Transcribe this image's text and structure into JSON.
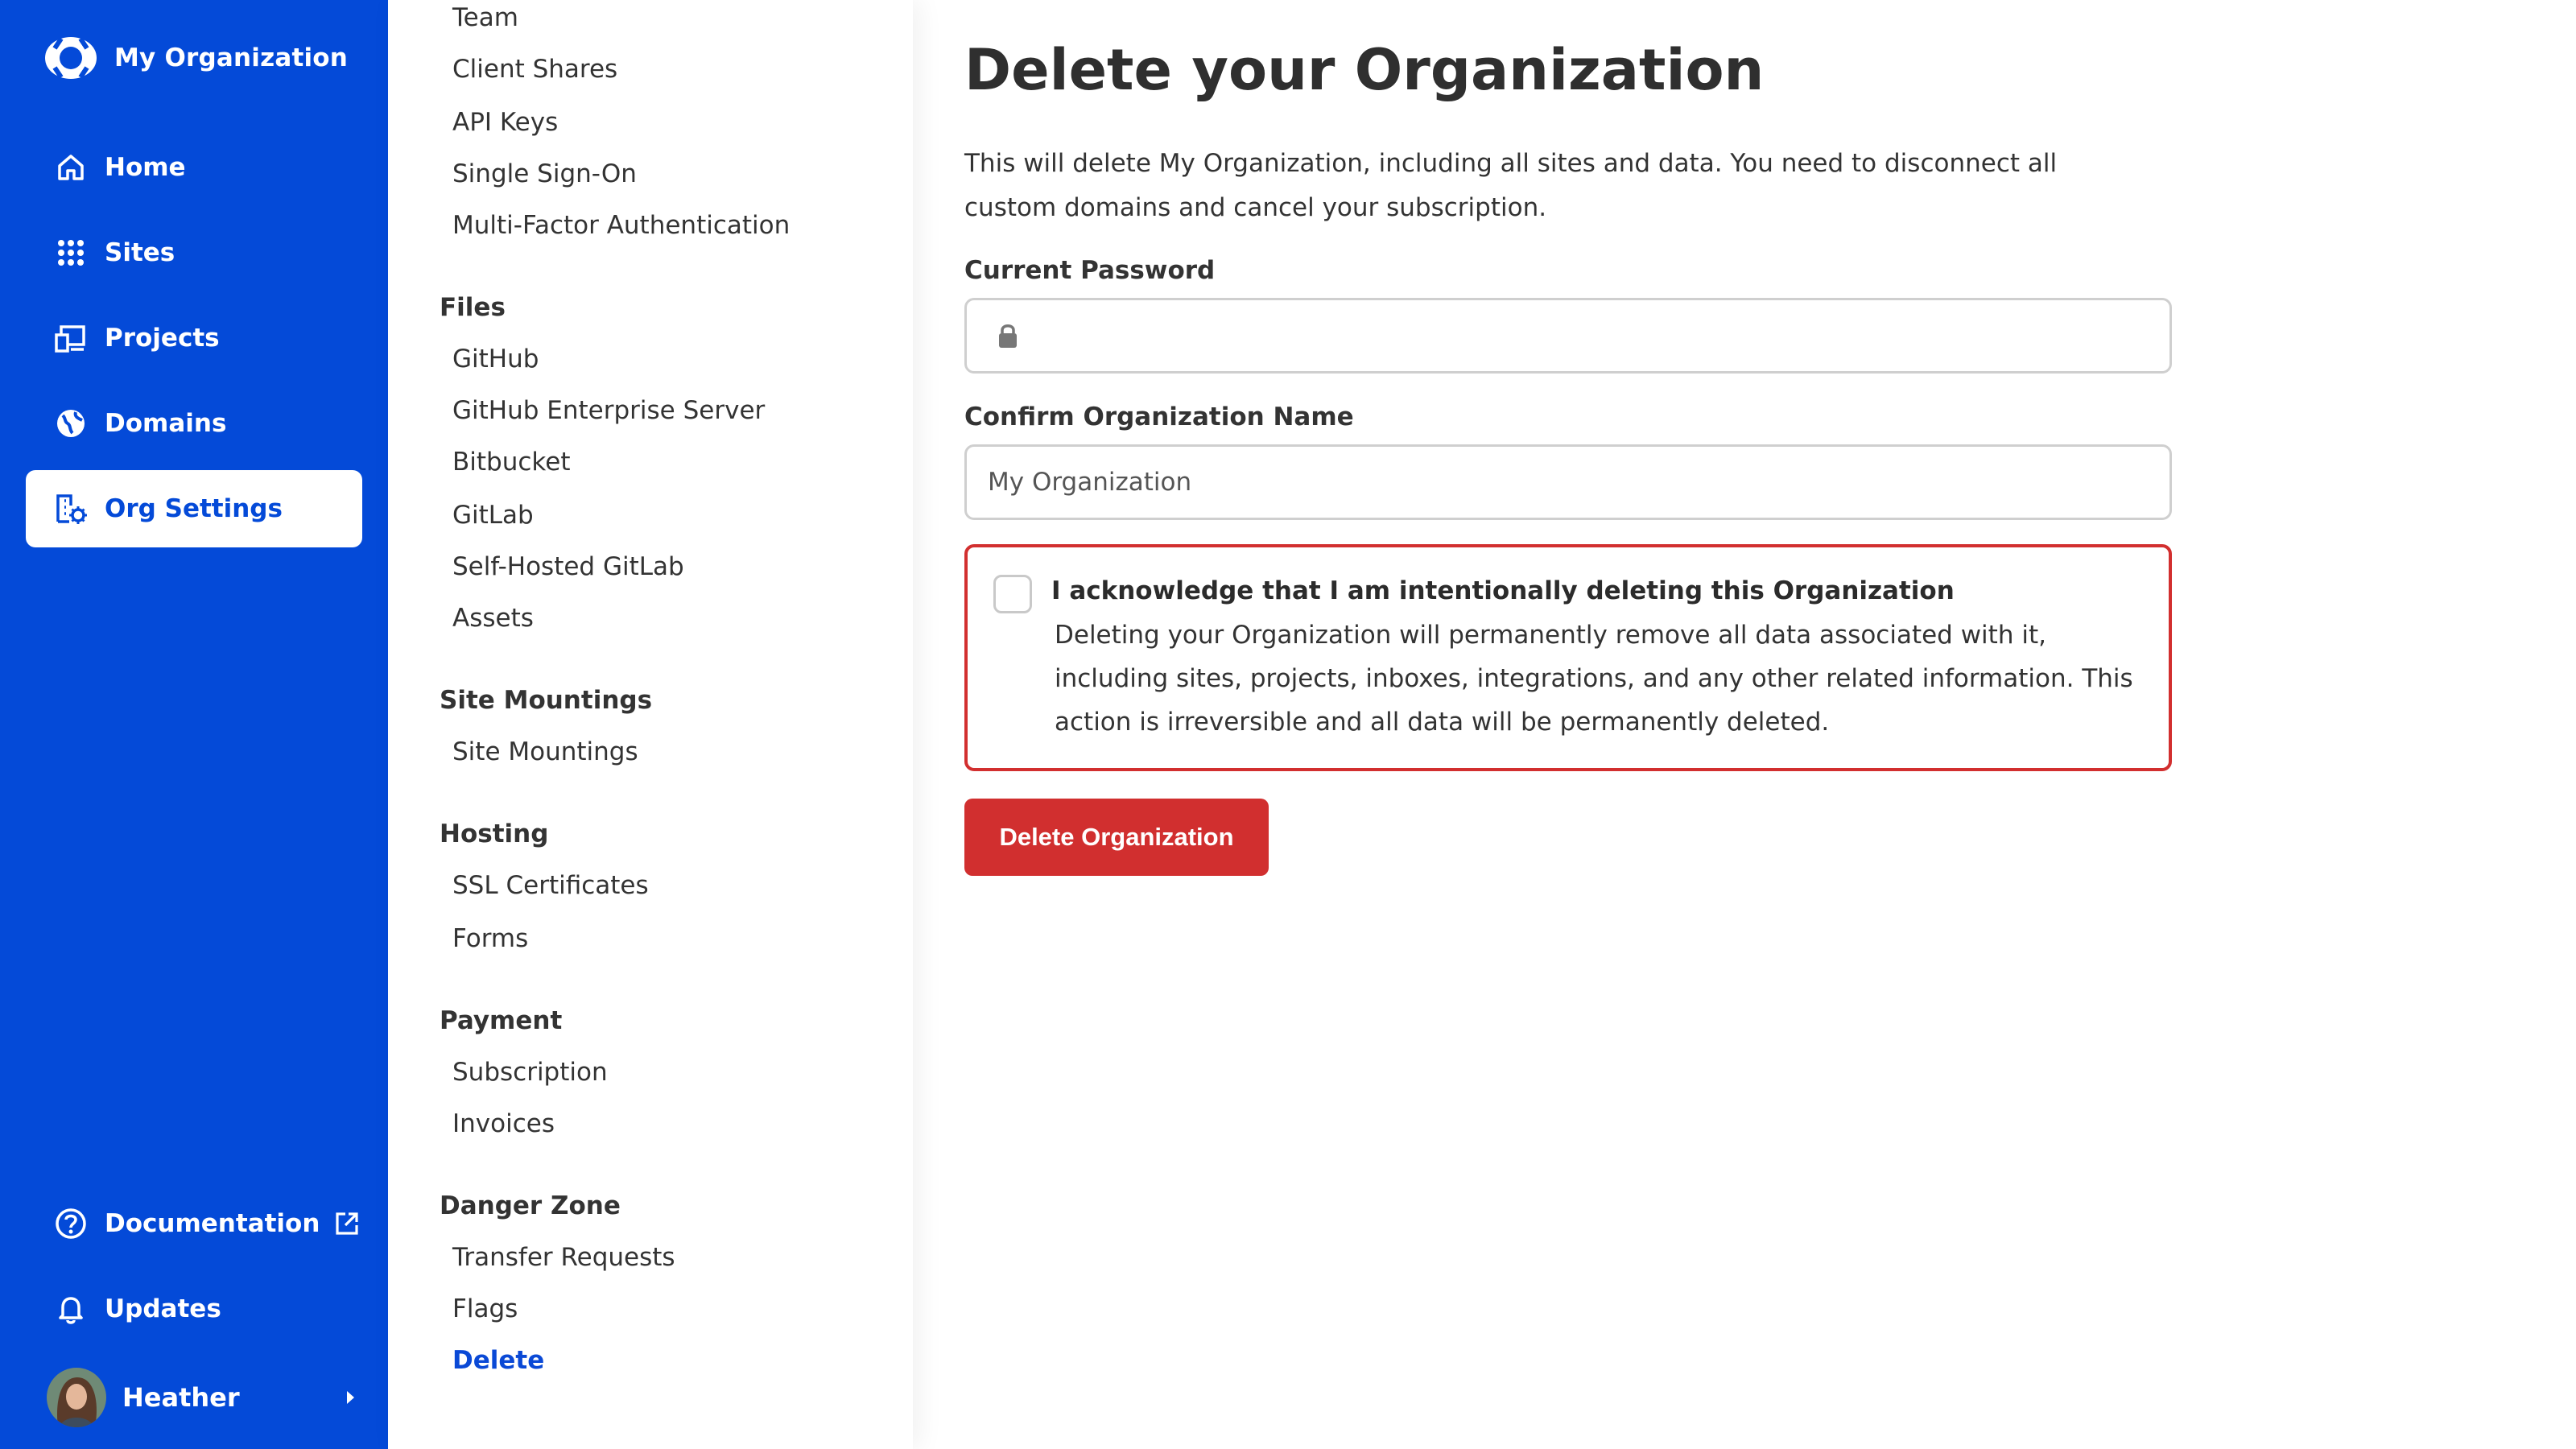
{
  "colors": {
    "sidebar_bg": "#044AD8",
    "danger": "#D12F2F",
    "active_link": "#0A49D6"
  },
  "brand": {
    "name": "My Organization",
    "logo_icon": "org-logo-icon"
  },
  "nav": {
    "items": [
      {
        "label": "Home",
        "icon": "home-icon"
      },
      {
        "label": "Sites",
        "icon": "grid-icon"
      },
      {
        "label": "Projects",
        "icon": "devices-icon"
      },
      {
        "label": "Domains",
        "icon": "globe-icon"
      },
      {
        "label": "Org Settings",
        "icon": "org-settings-icon",
        "active": true
      }
    ],
    "bottom": [
      {
        "label": "Documentation",
        "icon": "help-icon",
        "trailing_icon": "external-link-icon"
      },
      {
        "label": "Updates",
        "icon": "bell-icon"
      }
    ]
  },
  "user": {
    "name": "Heather"
  },
  "submenu": {
    "top_items": [
      "Team",
      "Client Shares",
      "API Keys",
      "Single Sign-On",
      "Multi-Factor Authentication"
    ],
    "sections": [
      {
        "title": "Files",
        "items": [
          "GitHub",
          "GitHub Enterprise Server",
          "Bitbucket",
          "GitLab",
          "Self-Hosted GitLab",
          "Assets"
        ]
      },
      {
        "title": "Site Mountings",
        "items": [
          "Site Mountings"
        ]
      },
      {
        "title": "Hosting",
        "items": [
          "SSL Certificates",
          "Forms"
        ]
      },
      {
        "title": "Payment",
        "items": [
          "Subscription",
          "Invoices"
        ]
      },
      {
        "title": "Danger Zone",
        "items": [
          "Transfer Requests",
          "Flags",
          "Delete"
        ]
      }
    ],
    "active_item": "Delete"
  },
  "main": {
    "title": "Delete your Organization",
    "description": "This will delete My Organization, including all sites and data. You need to disconnect all custom domains and cancel your subscription.",
    "password_label": "Current Password",
    "password_value": "",
    "org_name_label": "Confirm Organization Name",
    "org_name_placeholder": "My Organization",
    "ack_title": "I acknowledge that I am intentionally deleting this Organization",
    "ack_text": "Deleting your Organization will permanently remove all data associated with it, including sites, projects, inboxes, integrations, and any other related information. This action is irreversible and all data will be permanently deleted.",
    "ack_checked": false,
    "delete_button": "Delete Organization"
  }
}
